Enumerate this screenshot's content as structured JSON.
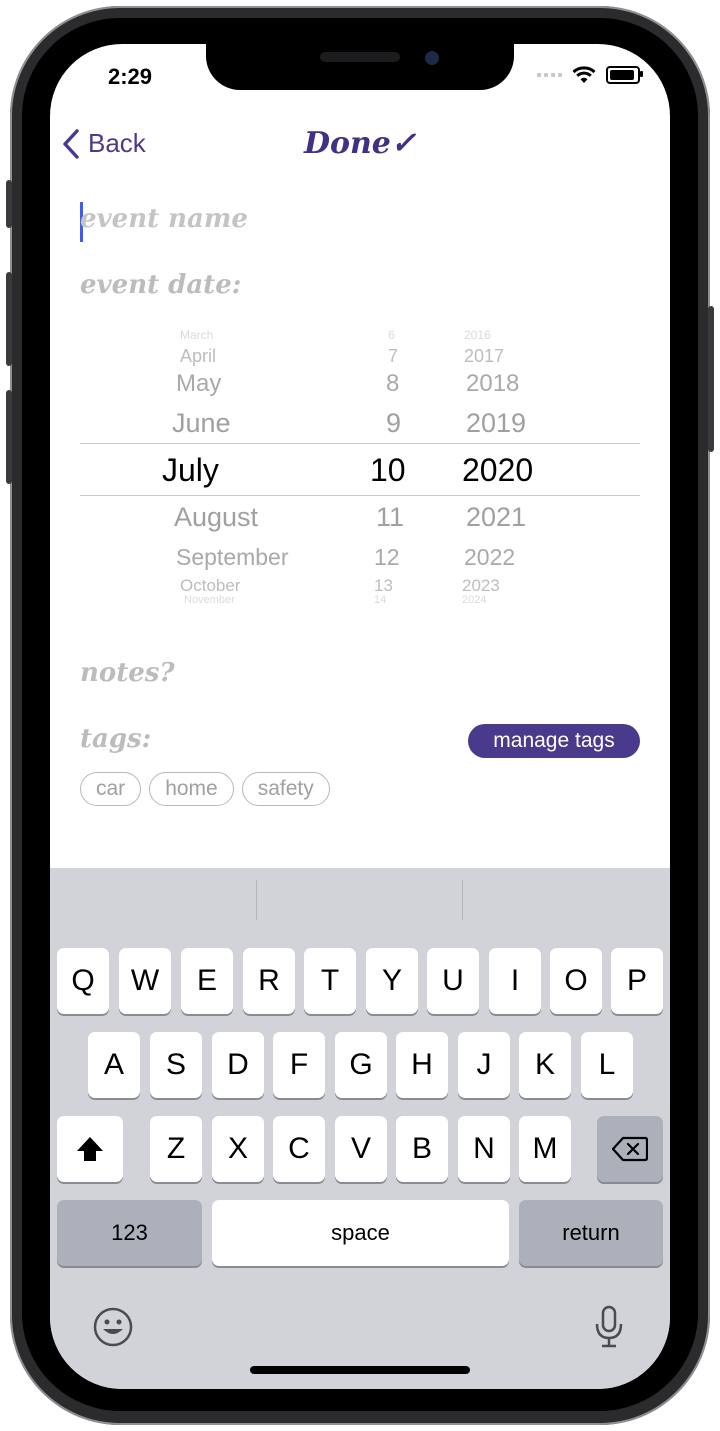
{
  "status": {
    "time": "2:29"
  },
  "nav": {
    "back_label": "Back",
    "done_label": "Done✓"
  },
  "form": {
    "event_name_placeholder": "event name",
    "event_date_label": "event date:",
    "notes_label": "notes?",
    "tags_label": "tags:",
    "manage_tags_label": "manage tags"
  },
  "picker": {
    "months": [
      "March",
      "April",
      "May",
      "June",
      "July",
      "August",
      "September",
      "October",
      "November"
    ],
    "days": [
      "6",
      "7",
      "8",
      "9",
      "10",
      "11",
      "12",
      "13",
      "14"
    ],
    "years": [
      "2016",
      "2017",
      "2018",
      "2019",
      "2020",
      "2021",
      "2022",
      "2023",
      "2024"
    ],
    "selected": {
      "month": "July",
      "day": "10",
      "year": "2020"
    }
  },
  "tags": [
    "car",
    "home",
    "safety"
  ],
  "keyboard": {
    "row1": [
      "Q",
      "W",
      "E",
      "R",
      "T",
      "Y",
      "U",
      "I",
      "O",
      "P"
    ],
    "row2": [
      "A",
      "S",
      "D",
      "F",
      "G",
      "H",
      "J",
      "K",
      "L"
    ],
    "row3": [
      "Z",
      "X",
      "C",
      "V",
      "B",
      "N",
      "M"
    ],
    "numbers_label": "123",
    "space_label": "space",
    "return_label": "return"
  },
  "colors": {
    "accent": "#493a8b",
    "done": "#3f3183",
    "cursor": "#3b5cf5"
  }
}
